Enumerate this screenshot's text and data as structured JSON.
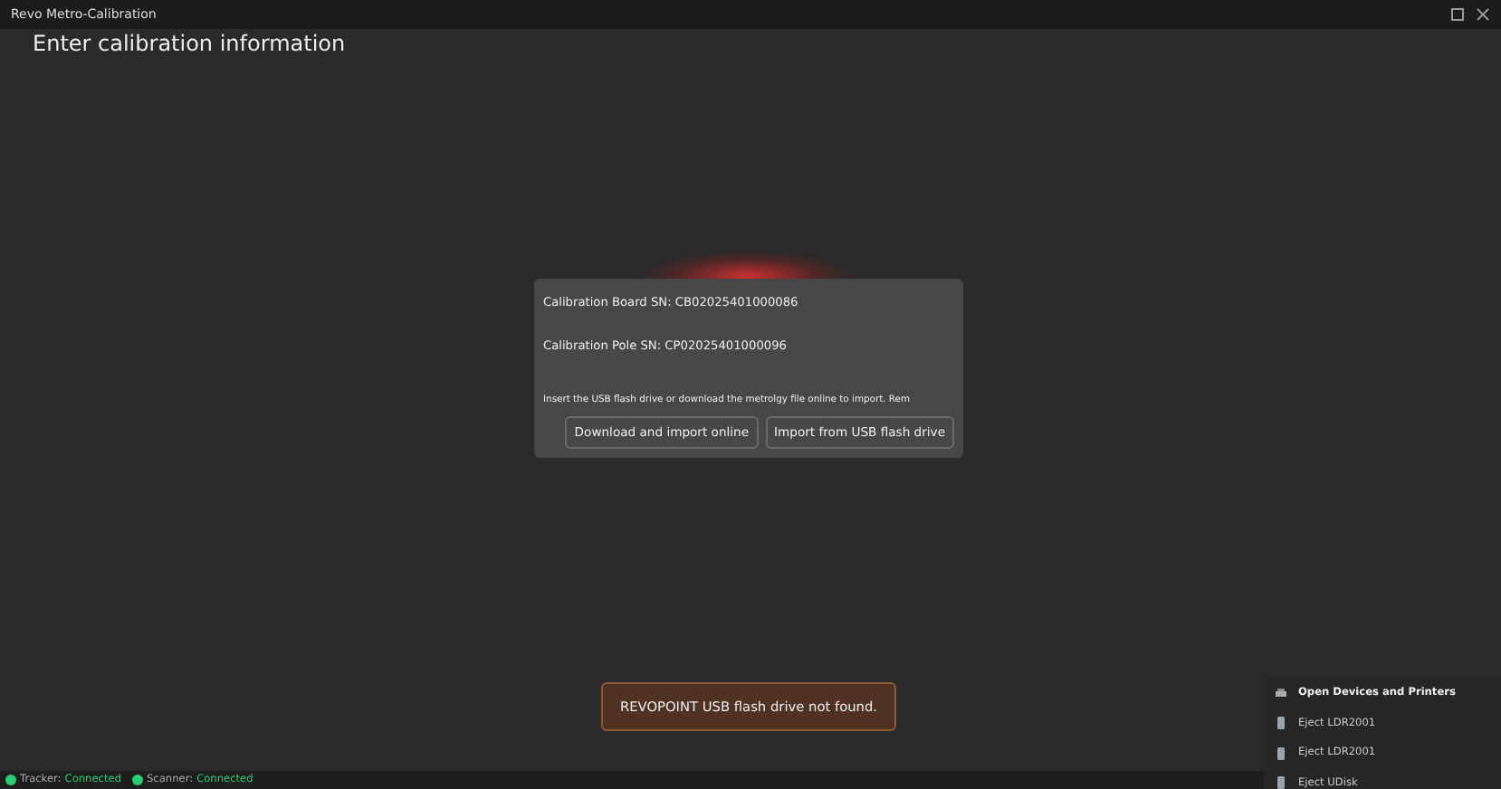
{
  "window": {
    "title": "Revo Metro-Calibration"
  },
  "heading": "Enter calibration information",
  "dialog": {
    "board_sn": "Calibration Board SN: CB02025401000086",
    "pole_sn": "Calibration Pole SN: CP02025401000096",
    "hint": "Insert the USB flash drive or download the metrolgy file online to import. Rem",
    "buttons": [
      "Download and import online",
      "Import from USB flash drive"
    ]
  },
  "toast": "REVOPOINT USB flash drive not found.",
  "tray_menu": {
    "items": [
      {
        "kind": "printers",
        "label": "Open Devices and Printers"
      },
      {
        "kind": "drive",
        "label": "Eject LDR2001"
      },
      {
        "kind": "drive",
        "label": "Eject LDR2001"
      },
      {
        "kind": "drive",
        "label": "Eject UDisk"
      }
    ]
  },
  "status_bar": [
    {
      "label": "Tracker:",
      "value": "Connected",
      "color": "#2ecc71"
    },
    {
      "label": "Scanner:",
      "value": "Connected",
      "color": "#2ecc71"
    }
  ]
}
